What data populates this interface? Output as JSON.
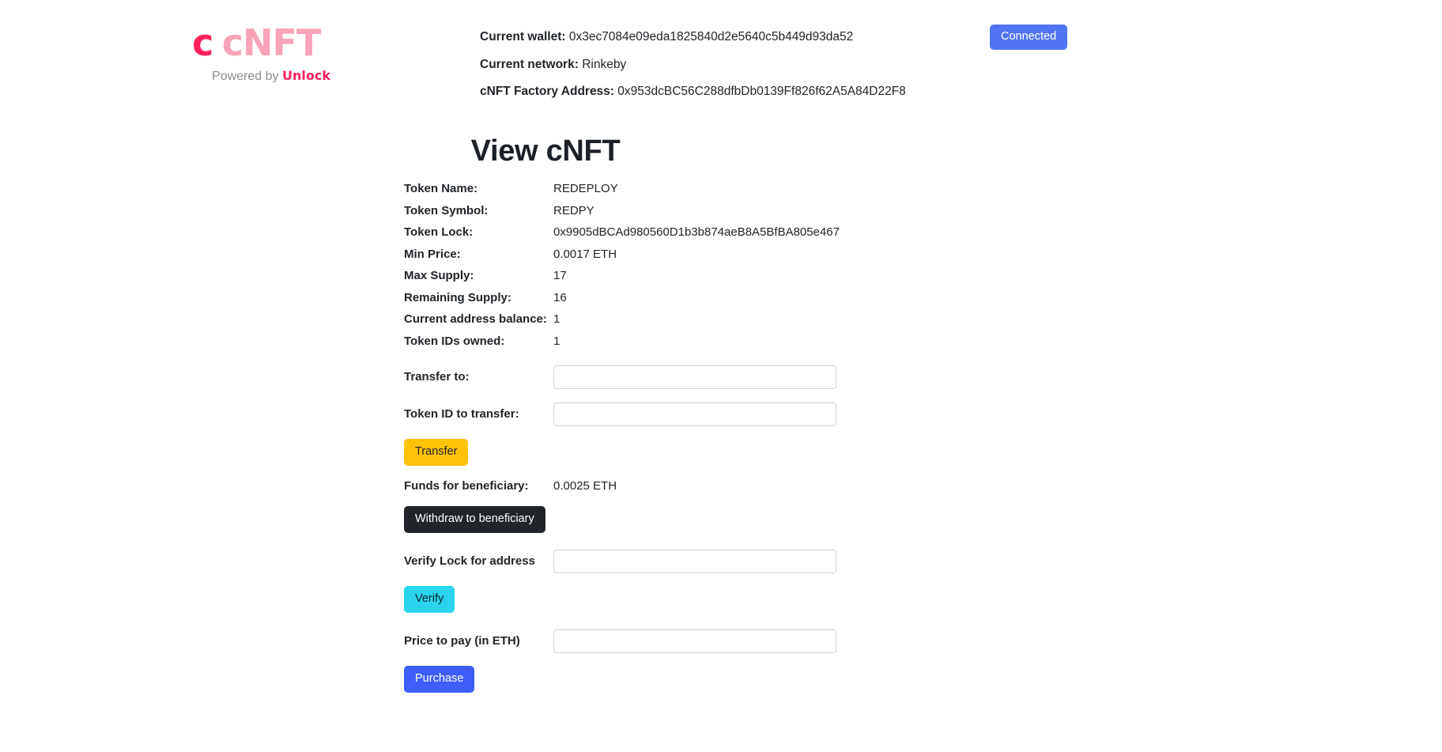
{
  "brand": {
    "logo_text": "cNFT",
    "logo_overlay": "c",
    "tagline_prefix": "Powered by ",
    "tagline_brand": "Unlock",
    "color_primary": "#ff1f5a",
    "color_secondary": "#f9a3b8"
  },
  "header": {
    "wallet_label": "Current wallet:",
    "wallet_value": "0x3ec7084e09eda1825840d2e5640c5b449d93da52",
    "network_label": "Current network:",
    "network_value": "Rinkeby",
    "factory_label": "cNFT Factory Address:",
    "factory_value": "0x953dcBC56C288dfbDb0139Ff826f62A5A84D22F8",
    "connected_button": "Connected",
    "connected_color": "#4f74f5"
  },
  "main": {
    "title": "View cNFT",
    "fields": [
      {
        "label": "Token Name:",
        "value": "REDEPLOY"
      },
      {
        "label": "Token Symbol:",
        "value": "REDPY"
      },
      {
        "label": "Token Lock:",
        "value": "0x9905dBCAd980560D1b3b874aeB8A5BfBA805e467"
      },
      {
        "label": "Min Price:",
        "value": "0.0017 ETH"
      },
      {
        "label": "Max Supply:",
        "value": "17"
      },
      {
        "label": "Remaining Supply:",
        "value": "16"
      },
      {
        "label": "Current address balance:",
        "value": "1"
      },
      {
        "label": "Token IDs owned:",
        "value": "1"
      }
    ],
    "transfer_to_label": "Transfer to:",
    "transfer_to_value": "",
    "transfer_to_placeholder": "",
    "token_id_label": "Token ID to transfer:",
    "token_id_value": "",
    "token_id_placeholder": "",
    "transfer_button": "Transfer",
    "transfer_button_color": "#ffc107",
    "funds_label": "Funds for beneficiary:",
    "funds_value": "0.0025 ETH",
    "withdraw_button": "Withdraw to beneficiary",
    "withdraw_button_color": "#212529",
    "verify_label": "Verify Lock for address",
    "verify_value": "",
    "verify_placeholder": "",
    "verify_button": "Verify",
    "verify_button_color": "#2ad4ee",
    "price_label": "Price to pay (in ETH)",
    "price_value": "",
    "price_placeholder": "",
    "purchase_button": "Purchase",
    "purchase_button_color": "#3d5efb"
  }
}
